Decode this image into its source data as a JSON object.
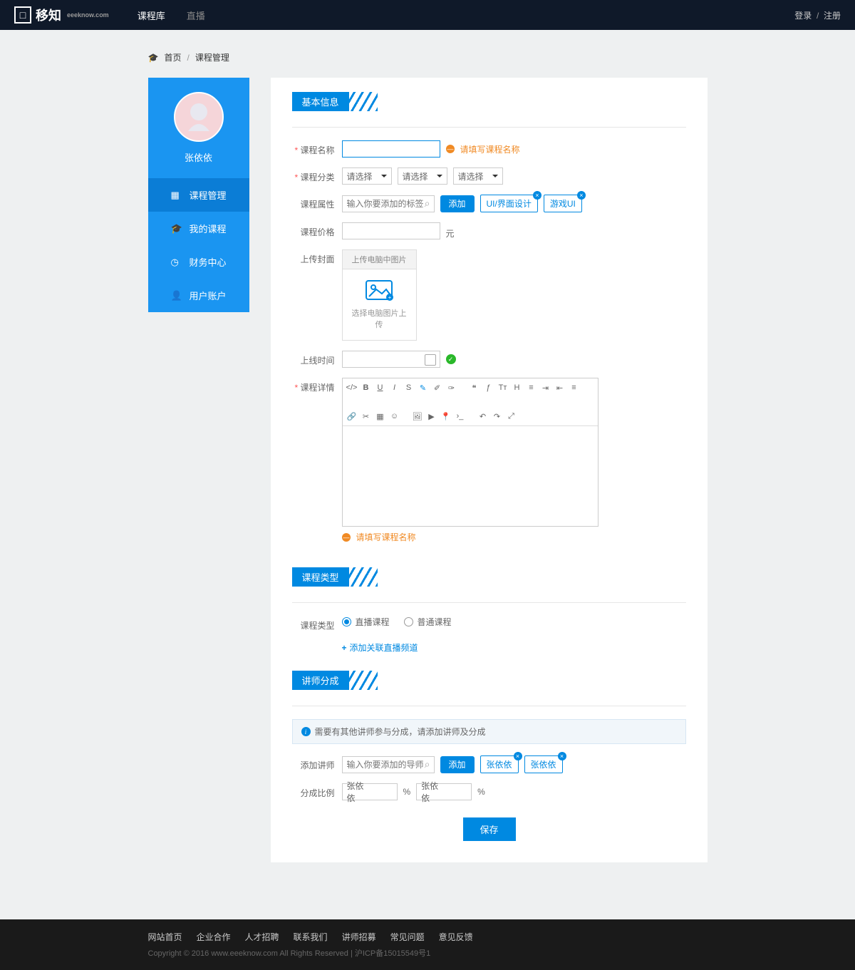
{
  "header": {
    "logo": "移知",
    "logo_sub": "eeeknow.com",
    "nav": [
      "课程库",
      "直播"
    ],
    "login": "登录",
    "register": "注册"
  },
  "breadcrumb": {
    "home": "首页",
    "current": "课程管理"
  },
  "sidebar": {
    "username": "张依依",
    "items": [
      {
        "icon": "calendar",
        "label": "课程管理"
      },
      {
        "icon": "cap",
        "label": "我的课程"
      },
      {
        "icon": "dash",
        "label": "财务中心"
      },
      {
        "icon": "user",
        "label": "用户账户"
      }
    ]
  },
  "sections": {
    "basic": "基本信息",
    "type": "课程类型",
    "share": "讲师分成"
  },
  "form": {
    "course_name": {
      "label": "课程名称",
      "error": "请填写课程名称"
    },
    "category": {
      "label": "课程分类",
      "placeholder": "请选择"
    },
    "attrs": {
      "label": "课程属性",
      "placeholder": "输入你要添加的标签",
      "btn": "添加",
      "tags": [
        "UI/界面设计",
        "游戏UI"
      ]
    },
    "price": {
      "label": "课程价格",
      "unit": "元"
    },
    "cover": {
      "label": "上传封面",
      "tab": "上传电脑中图片",
      "hint": "选择电脑图片上传"
    },
    "online_time": {
      "label": "上线时间"
    },
    "detail": {
      "label": "课程详情",
      "error": "请填写课程名称"
    },
    "course_type": {
      "label": "课程类型",
      "opt1": "直播课程",
      "opt2": "普通课程",
      "add_link": "添加关联直播频道"
    },
    "share_info": "需要有其他讲师参与分成，请添加讲师及分成",
    "add_teacher": {
      "label": "添加讲师",
      "placeholder": "输入你要添加的导师",
      "btn": "添加",
      "tags": [
        "张依依",
        "张依依"
      ]
    },
    "ratio": {
      "label": "分成比例",
      "names": [
        "张依依",
        "张依依"
      ],
      "unit": "%"
    },
    "save": "保存"
  },
  "footer": {
    "links": [
      "网站首页",
      "企业合作",
      "人才招聘",
      "联系我们",
      "讲师招募",
      "常见问题",
      "意见反馈"
    ],
    "copyright": "Copyright © 2016 www.eeeknow.com All Rights Reserved | 沪ICP备15015549号1"
  }
}
